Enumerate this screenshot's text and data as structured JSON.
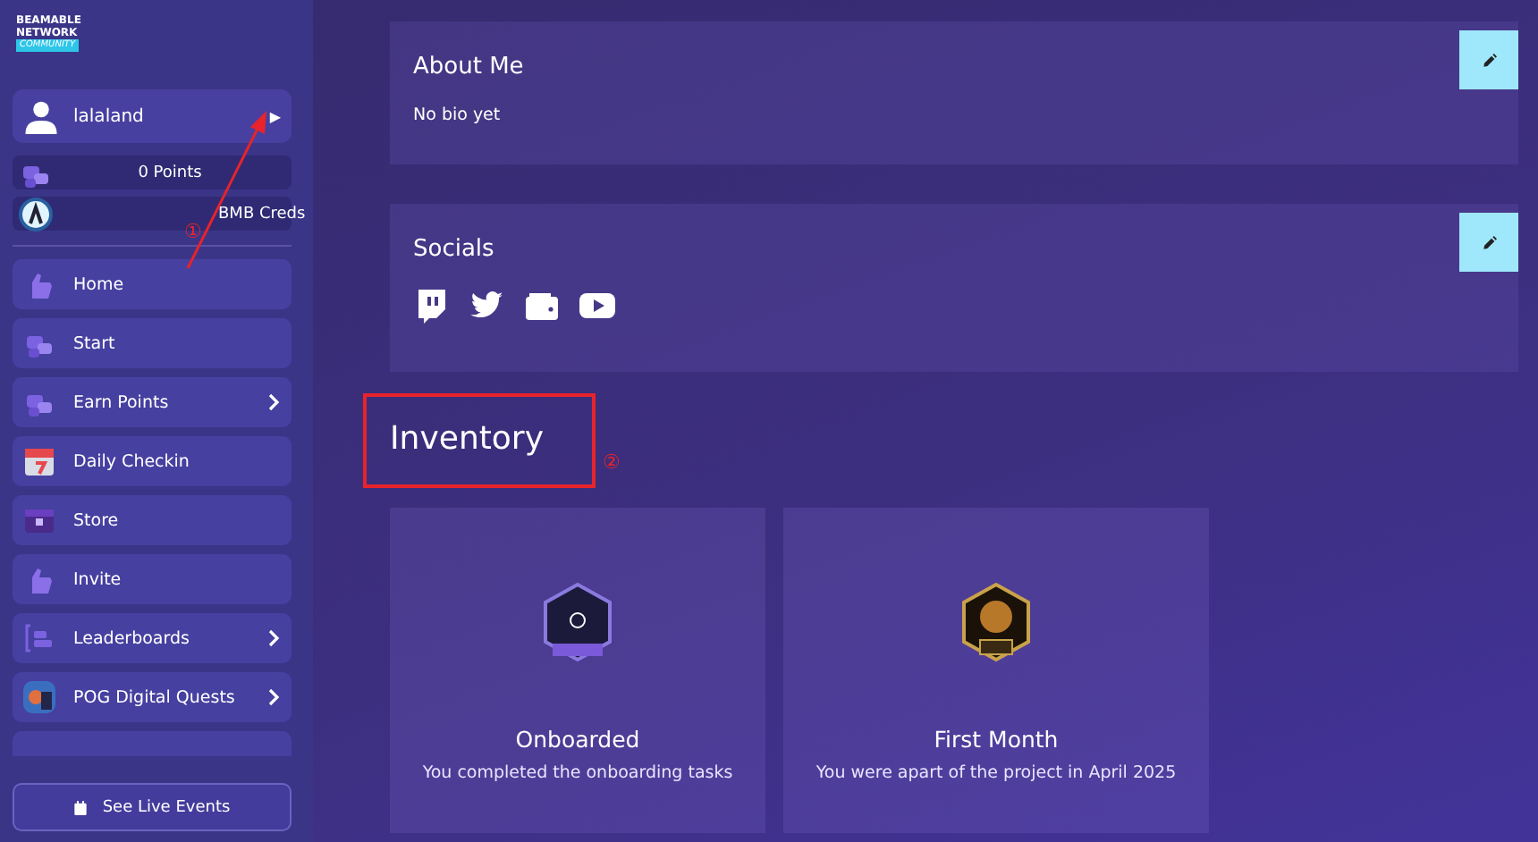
{
  "logo": {
    "line_1": "BEAMABLE",
    "line_2": "NETWORK",
    "tag": "COMMUNITY"
  },
  "user": {
    "name": "lalaland",
    "caret": "▶"
  },
  "balances": [
    {
      "kind": "points",
      "label": "0 Points"
    },
    {
      "kind": "creds",
      "label": "BMB Creds"
    }
  ],
  "nav": [
    {
      "label": "Home",
      "has_submenu": false
    },
    {
      "label": "Start",
      "has_submenu": false
    },
    {
      "label": "Earn Points",
      "has_submenu": true
    },
    {
      "label": "Daily Checkin",
      "has_submenu": false
    },
    {
      "label": "Store",
      "has_submenu": false
    },
    {
      "label": "Invite",
      "has_submenu": false
    },
    {
      "label": "Leaderboards",
      "has_submenu": true
    },
    {
      "label": "POG Digital Quests",
      "has_submenu": true
    }
  ],
  "live_events_button": "See Live Events",
  "about": {
    "title": "About Me",
    "text": "No bio yet"
  },
  "socials": {
    "title": "Socials"
  },
  "inventory": {
    "title": "Inventory",
    "items": [
      {
        "kind": "onboarded",
        "title": "Onboarded",
        "description": "You completed the onboarding tasks"
      },
      {
        "kind": "first",
        "title": "First Month",
        "description": "You were apart of the project in April 2025"
      }
    ]
  },
  "annotations": [
    {
      "kind": "arrow",
      "label": "①"
    },
    {
      "kind": "box",
      "label": "②"
    }
  ]
}
